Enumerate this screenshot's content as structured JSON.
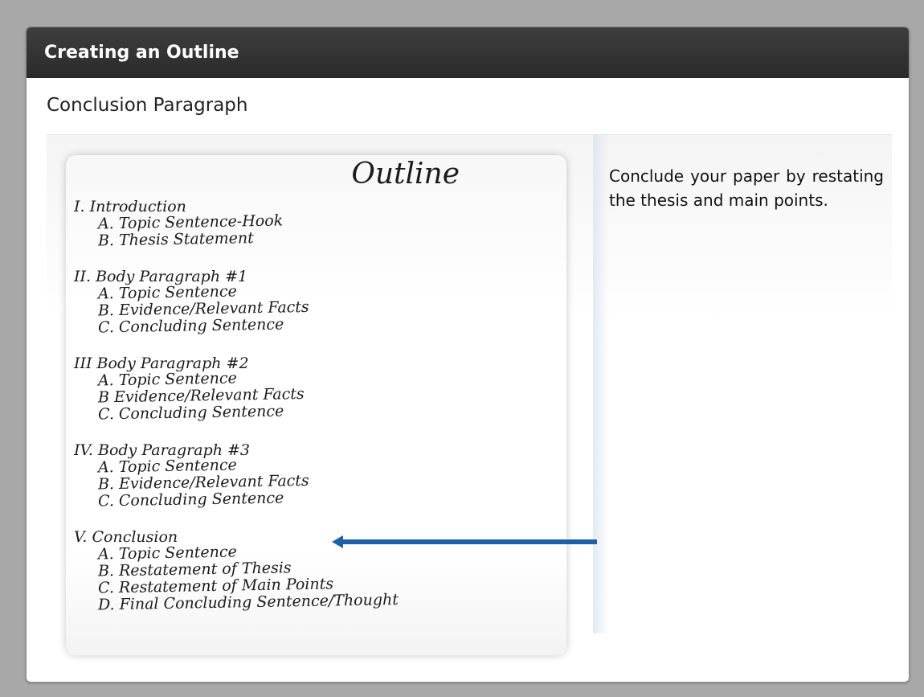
{
  "window": {
    "title": "Creating an Outline"
  },
  "slide": {
    "subtitle": "Conclusion Paragraph",
    "description": "Conclude your paper by restating the thesis and main points."
  },
  "outline": {
    "title": "Outline",
    "sections": [
      {
        "heading": "I. Introduction",
        "items": [
          "A. Topic Sentence-Hook",
          "B. Thesis Statement"
        ]
      },
      {
        "heading": "II. Body Paragraph #1",
        "items": [
          "A. Topic Sentence",
          "B. Evidence/Relevant Facts",
          "C. Concluding Sentence"
        ]
      },
      {
        "heading": "III Body Paragraph #2",
        "items": [
          "A. Topic Sentence",
          "B Evidence/Relevant Facts",
          "C. Concluding Sentence"
        ]
      },
      {
        "heading": "IV. Body Paragraph #3",
        "items": [
          "A. Topic Sentence",
          "B. Evidence/Relevant Facts",
          "C. Concluding Sentence"
        ]
      },
      {
        "heading": "V. Conclusion",
        "items": [
          "A. Topic Sentence",
          "B. Restatement of Thesis",
          "C. Restatement of Main Points",
          "D. Final Concluding Sentence/Thought"
        ]
      }
    ]
  },
  "colors": {
    "titlebar": "#2e2e2e",
    "arrow": "#1f5fa8"
  },
  "icons": {
    "pointer": "left-arrow-icon"
  }
}
